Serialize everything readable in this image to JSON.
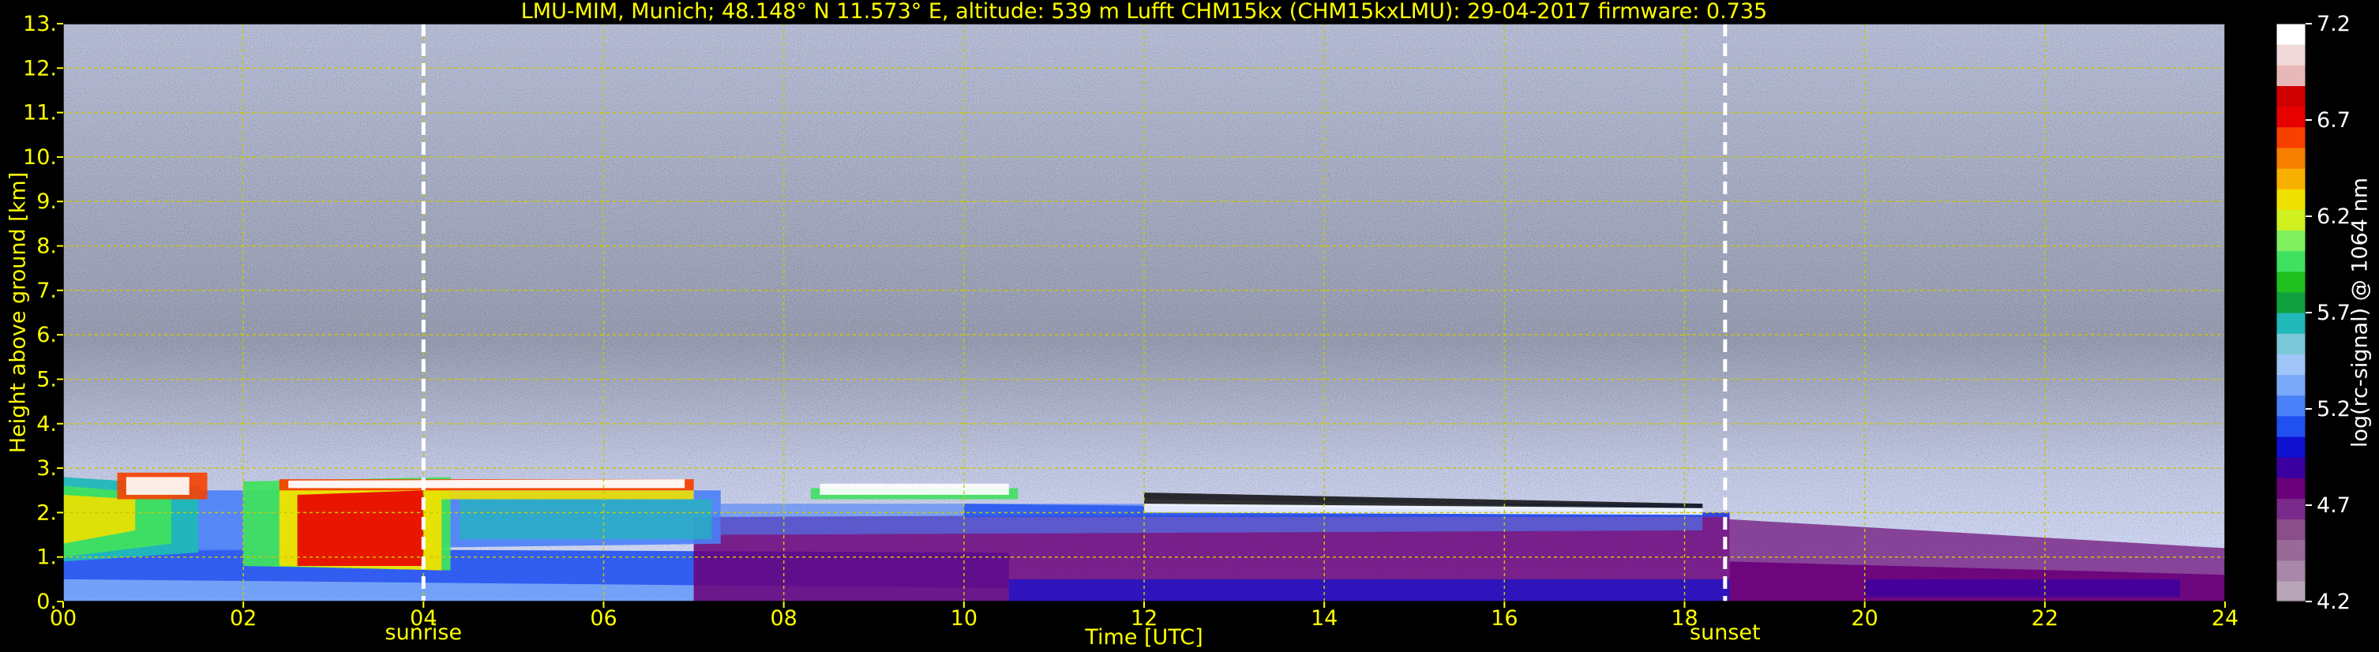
{
  "chart_data": {
    "type": "heatmap",
    "title": "LMU-MIM, Munich; 48.148° N 11.573° E, altitude: 539 m     Lufft CHM15kx (CHM15kxLMU): 29-04-2017     firmware: 0.735",
    "xlabel": "Time [UTC]",
    "ylabel": "Height above ground [km]",
    "colorbar_label": "log(rc-signal) @ 1064 nm",
    "xlim": [
      0,
      24
    ],
    "ylim": [
      0,
      13
    ],
    "x_ticks": [
      {
        "value": 0,
        "label": "00"
      },
      {
        "value": 2,
        "label": "02"
      },
      {
        "value": 4,
        "label": "04"
      },
      {
        "value": 6,
        "label": "06"
      },
      {
        "value": 8,
        "label": "08"
      },
      {
        "value": 10,
        "label": "10"
      },
      {
        "value": 12,
        "label": "12"
      },
      {
        "value": 14,
        "label": "14"
      },
      {
        "value": 16,
        "label": "16"
      },
      {
        "value": 18,
        "label": "18"
      },
      {
        "value": 20,
        "label": "20"
      },
      {
        "value": 22,
        "label": "22"
      },
      {
        "value": 24,
        "label": "24"
      }
    ],
    "y_ticks": [
      {
        "value": 0,
        "label": "0."
      },
      {
        "value": 1,
        "label": "1."
      },
      {
        "value": 2,
        "label": "2."
      },
      {
        "value": 3,
        "label": "3."
      },
      {
        "value": 4,
        "label": "4."
      },
      {
        "value": 5,
        "label": "5."
      },
      {
        "value": 6,
        "label": "6."
      },
      {
        "value": 7,
        "label": "7."
      },
      {
        "value": 8,
        "label": "8."
      },
      {
        "value": 9,
        "label": "9."
      },
      {
        "value": 10,
        "label": "10."
      },
      {
        "value": 11,
        "label": "11."
      },
      {
        "value": 12,
        "label": "12."
      },
      {
        "value": 13,
        "label": "13."
      }
    ],
    "colorbar_range": [
      4.2,
      7.2
    ],
    "colorbar_ticks": [
      {
        "value": 4.2,
        "label": "4.2"
      },
      {
        "value": 4.7,
        "label": "4.7"
      },
      {
        "value": 5.2,
        "label": "5.2"
      },
      {
        "value": 5.7,
        "label": "5.7"
      },
      {
        "value": 6.2,
        "label": "6.2"
      },
      {
        "value": 6.7,
        "label": "6.7"
      },
      {
        "value": 7.2,
        "label": "7.2"
      }
    ],
    "colormap": [
      "#b8a6b8",
      "#a888a8",
      "#986a98",
      "#8a4e8a",
      "#7a2a8a",
      "#6a007a",
      "#3a00a0",
      "#1010d0",
      "#2050f0",
      "#4a80f8",
      "#7aa8f8",
      "#a0c4f8",
      "#7ac8d8",
      "#20b8b8",
      "#10a040",
      "#20c020",
      "#40e060",
      "#80f060",
      "#d0f020",
      "#f0e000",
      "#f8b000",
      "#f88000",
      "#f84000",
      "#e80000",
      "#d00000",
      "#e8b8b8",
      "#f0d8d8",
      "#ffffff"
    ],
    "annotations": [
      {
        "x": 4.0,
        "label": "sunrise",
        "style": "white-dashed-line"
      },
      {
        "x": 18.45,
        "label": "sunset",
        "style": "white-dashed-line"
      }
    ],
    "grid": true,
    "grid_color": "#c8c800",
    "text_color": "#ffff00",
    "background_noise_color": "#8a7aa0"
  }
}
